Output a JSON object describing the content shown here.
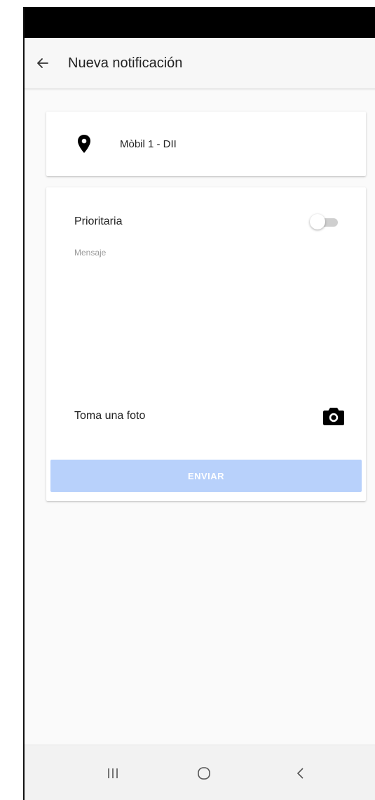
{
  "header": {
    "title": "Nueva notificación",
    "back_icon": "arrow-left-icon"
  },
  "location": {
    "icon": "location-pin-icon",
    "label": "Mòbil 1 - DII"
  },
  "form": {
    "priority_label": "Prioritaria",
    "priority_on": false,
    "message_placeholder": "Mensaje",
    "message_value": "",
    "photo_label": "Toma una foto",
    "camera_icon": "camera-icon",
    "send_label": "ENVIAR"
  },
  "nav": {
    "recents_icon": "recents-icon",
    "home_icon": "home-icon",
    "back_icon": "back-chevron-icon"
  },
  "colors": {
    "send_button_disabled": "#b8d1fb",
    "status_bar": "#000000"
  }
}
